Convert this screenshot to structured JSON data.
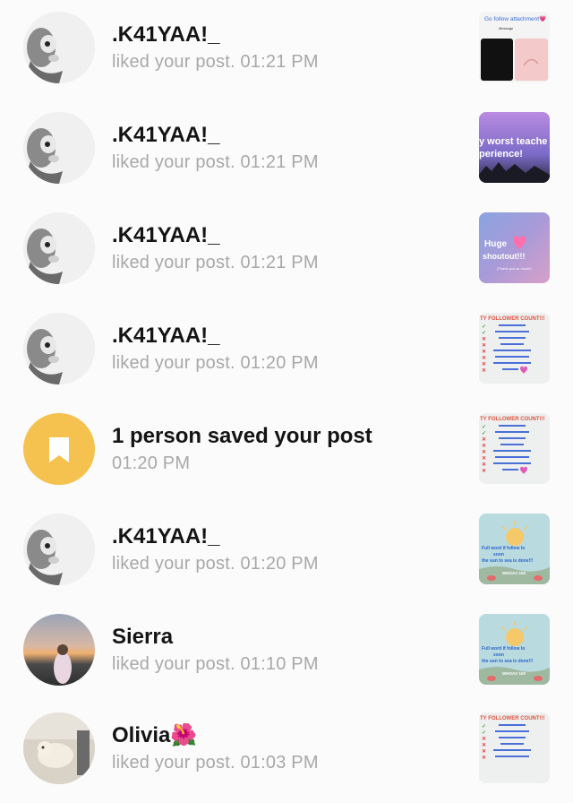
{
  "notifications": [
    {
      "name": ".K41YAA!_",
      "action": "liked your post.",
      "time": "01:21 PM",
      "avatar": "husky-avatar",
      "thumb": "dm-screenshot"
    },
    {
      "name": ".K41YAA!_",
      "action": "liked your post.",
      "time": "01:21 PM",
      "avatar": "husky-avatar",
      "thumb": "worst-teacher"
    },
    {
      "name": ".K41YAA!_",
      "action": "liked your post.",
      "time": "01:21 PM",
      "avatar": "husky-avatar",
      "thumb": "huge-shoutout"
    },
    {
      "name": ".K41YAA!_",
      "action": "liked your post.",
      "time": "01:20 PM",
      "avatar": "husky-avatar",
      "thumb": "follower-count"
    },
    {
      "name": "1 person saved your post",
      "action": "",
      "time": "01:20 PM",
      "avatar": "bookmark-icon",
      "thumb": "follower-count"
    },
    {
      "name": ".K41YAA!_",
      "action": "liked your post.",
      "time": "01:20 PM",
      "avatar": "husky-avatar",
      "thumb": "beach-sunset"
    },
    {
      "name": "Sierra",
      "action": "liked your post.",
      "time": "01:10 PM",
      "avatar": "sunset-photo-avatar",
      "thumb": "beach-sunset"
    },
    {
      "name": "Olivia🌺",
      "action": "liked your post.",
      "time": "01:03 PM",
      "avatar": "dog-photo-avatar",
      "thumb": "follower-count"
    }
  ],
  "thumb_text": {
    "dm_screenshot_header": "Go follow attachment💗",
    "dm_screenshot_sub": "Message",
    "worst_teacher_l1": "y worst teache",
    "worst_teacher_l2": "perience!",
    "huge_shoutout_l1": "Huge",
    "huge_shoutout_l2": "shoutout!!!",
    "huge_shoutout_l3": "(Thank you so much!)",
    "follower_count_title": "TY FOLLOWER COUNT!!!",
    "beach_l1": "Full word if follow lo",
    "beach_l2": "soon",
    "beach_l3": "the sun to sea is done!!!",
    "beach_l4": "WHOA!! 100"
  },
  "colors": {
    "name_text": "#141414",
    "sub_text": "#a8a8a8",
    "bookmark_circle": "#f5c24f",
    "background": "#fbfbfb"
  }
}
